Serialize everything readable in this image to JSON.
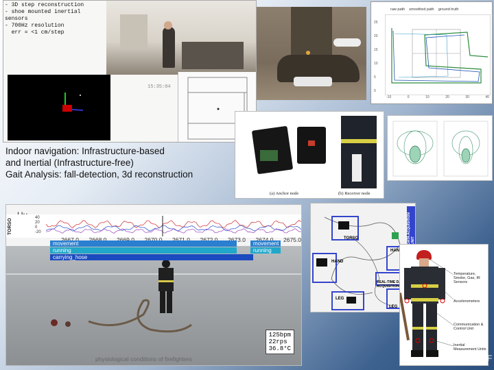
{
  "top_left_panel": {
    "notes": [
      "- 3D step reconstruction",
      "- shoe mounted inertial sensors",
      "- 700Hz resolution",
      "  err = <1 cm/step"
    ],
    "timestamp": "15:35:04"
  },
  "caption": {
    "line1": "Indoor navigation: Infrastructure-based",
    "line2": "and Inertial (Infrastructure-free)",
    "line3": "Gait Analysis: fall-detection, 3d reconstruction"
  },
  "trajectory_plot": {
    "legend": [
      "raw path",
      "smoothed path",
      "ground truth"
    ],
    "yticks": [
      "25",
      "20",
      "15",
      "10",
      "5",
      "0"
    ],
    "xticks": [
      "-10",
      "0",
      "10",
      "20",
      "30",
      "40"
    ]
  },
  "nodes_photo": {
    "anchor_caption": "(a) Anchor node",
    "receiver_caption": "(b) Receiver node"
  },
  "video_panel": {
    "hu_label": "Hu",
    "torso_label": "TORSO",
    "ytick_labels": [
      "40",
      "20",
      "0",
      "-20"
    ],
    "time_ticks": [
      "2667.0",
      "2668.0",
      "2669.0",
      "2670.0",
      "2671.0",
      "2672.0",
      "2673.0",
      "2674.0",
      "2675.0"
    ],
    "activities": [
      {
        "label": "movement",
        "color": "#2a7fd0"
      },
      {
        "label": "running",
        "color": "#21a7c9"
      },
      {
        "label": "carrying_hose",
        "color": "#1c4bbf"
      }
    ],
    "right_activities": [
      "movement",
      "running"
    ],
    "vitals": [
      "125bpm",
      "22rps",
      "36.8°C"
    ],
    "subtitle": "physiological conditions of firefighters"
  },
  "sensor_photo": {
    "labels": [
      "TORSO",
      "HAND",
      "HAND",
      "LEG",
      "LEG",
      "REAL-TIME DATA ACQUISITION UNIT",
      "DATA ACQUISITION UNIT"
    ]
  },
  "firefighter_figure": {
    "callouts": [
      "Temperature, Smoke, Gas, IR Sensors",
      "Accelerometers",
      "Communication & Control Unit",
      "Inertial Measurement Units"
    ]
  },
  "corner_letter": "F"
}
